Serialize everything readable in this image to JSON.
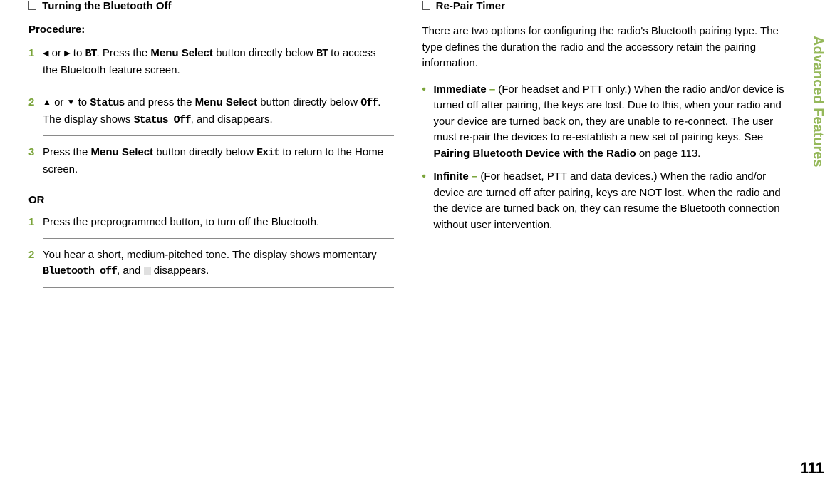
{
  "sideLabel": "Advanced Features",
  "pageNumber": "111",
  "left": {
    "heading": "Turning the Bluetooth Off",
    "procedureLabel": "Procedure:",
    "steps1": [
      {
        "num": "1",
        "pre1": "or",
        "pre2": "to",
        "mono1": "BT",
        "mid1": ". Press the ",
        "bold1": "Menu Select",
        "mid2": " button directly below ",
        "mono2": "BT",
        "end": " to access the Bluetooth feature screen."
      },
      {
        "num": "2",
        "pre1": "or",
        "pre2": "to",
        "mono1": "Status",
        "mid1": " and press the ",
        "bold1": "Menu Select",
        "mid2": " button directly below ",
        "mono2": "Off",
        "mid3": ". The display shows ",
        "mono3": "Status Off",
        "end": ", and disappears."
      },
      {
        "num": "3",
        "mid1": "Press the ",
        "bold1": "Menu Select",
        "mid2": " button directly below ",
        "mono1": "Exit",
        "end": " to return to the Home screen."
      }
    ],
    "or": "OR",
    "steps2": [
      {
        "num": "1",
        "text": "Press the preprogrammed button, to turn off the Bluetooth."
      },
      {
        "num": "2",
        "pre": "You hear a short, medium-pitched tone. The display shows momentary ",
        "mono": "Bluetooth off",
        "mid": ", and ",
        "end": " disappears."
      }
    ]
  },
  "right": {
    "heading": "Re-Pair Timer",
    "intro": "There are two options for configuring the radio's Bluetooth pairing type. The type defines the duration the radio and the accessory retain the pairing information.",
    "items": [
      {
        "title": "Immediate",
        "dash": " – ",
        "body1": "(For headset and PTT only.) When the radio and/or device is turned off after pairing, the keys are lost. Due to this, when your radio and your device are turned back on, they are unable to re-connect. The user must re-pair the devices to re-establish a new set of pairing keys. See ",
        "bold": "Pairing Bluetooth Device with the Radio",
        "body2": " on page 113."
      },
      {
        "title": "Infinite",
        "dash": " – ",
        "body1": "(For headset, PTT and data devices.) When the radio and/or device are turned off after pairing, keys are NOT lost. When the radio and the device are turned back on, they can resume the Bluetooth connection without user intervention.",
        "bold": "",
        "body2": ""
      }
    ]
  }
}
